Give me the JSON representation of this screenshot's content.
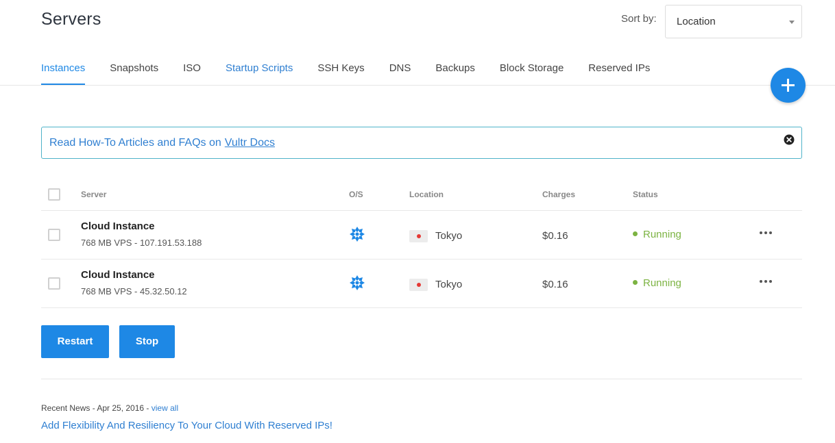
{
  "header": {
    "title": "Servers",
    "sort_label": "Sort by:",
    "sort_value": "Location"
  },
  "tabs": [
    {
      "label": "Instances",
      "active": true
    },
    {
      "label": "Snapshots"
    },
    {
      "label": "ISO"
    },
    {
      "label": "Startup Scripts"
    },
    {
      "label": "SSH Keys"
    },
    {
      "label": "DNS"
    },
    {
      "label": "Backups"
    },
    {
      "label": "Block Storage"
    },
    {
      "label": "Reserved IPs"
    }
  ],
  "fab": {
    "icon": "plus-icon"
  },
  "notice": {
    "text": "Read How-To Articles and FAQs on",
    "link": "Vultr Docs",
    "close_icon": "close-circle-icon"
  },
  "table": {
    "headers": {
      "server": "Server",
      "os": "O/S",
      "location": "Location",
      "charges": "Charges",
      "status": "Status"
    },
    "rows": [
      {
        "name": "Cloud Instance",
        "desc": "768 MB VPS - 107.191.53.188",
        "os_icon": "os-logo-icon",
        "flag": "japan-flag-icon",
        "location": "Tokyo",
        "charges": "$0.16",
        "status": "Running"
      },
      {
        "name": "Cloud Instance",
        "desc": "768 MB VPS - 45.32.50.12",
        "os_icon": "os-logo-icon",
        "flag": "japan-flag-icon",
        "location": "Tokyo",
        "charges": "$0.16",
        "status": "Running"
      }
    ]
  },
  "actions": {
    "restart": "Restart",
    "stop": "Stop"
  },
  "news": {
    "meta": "Recent News - Apr 25, 2016 -",
    "view_all": "view all",
    "headline": "Add Flexibility And Resiliency To Your Cloud With Reserved IPs!"
  },
  "colors": {
    "accent": "#1e88e5",
    "link": "#2f7fd1",
    "running": "#7cb342",
    "notice_border": "#4fb3c9"
  }
}
